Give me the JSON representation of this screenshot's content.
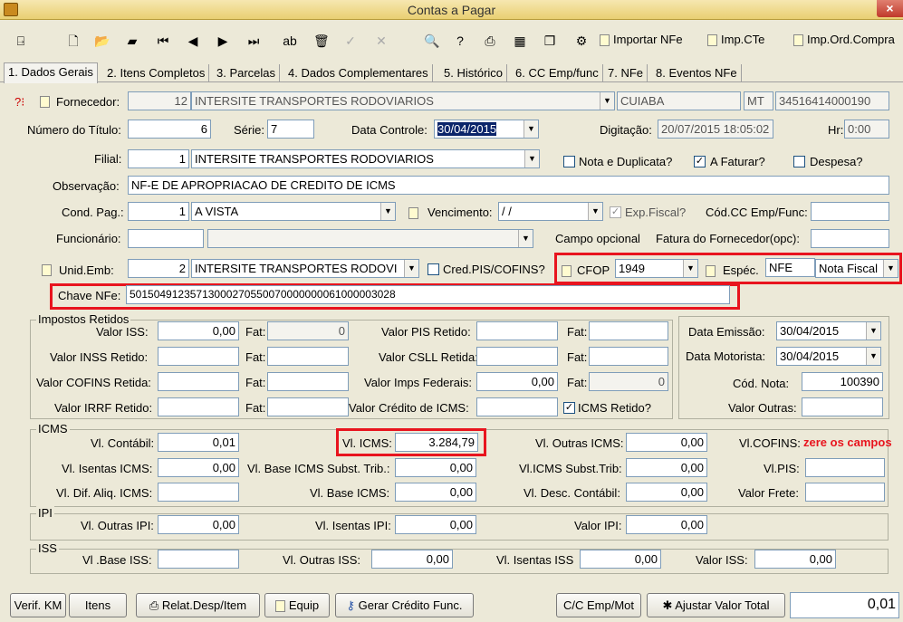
{
  "window": {
    "title": "Contas a Pagar",
    "close_glyph": "×"
  },
  "toolbar": {
    "importar_nfe": "Importar NFe",
    "imp_cte": "Imp.CTe",
    "imp_ord_compra": "Imp.Ord.Compra"
  },
  "tabs": [
    {
      "label": "1. Dados Gerais"
    },
    {
      "label": "2. Itens Completos"
    },
    {
      "label": "3. Parcelas"
    },
    {
      "label": "4. Dados Complementares"
    },
    {
      "label": "5. Histórico"
    },
    {
      "label": "6. CC Emp/func"
    },
    {
      "label": "7. NFe"
    },
    {
      "label": "8. Eventos NFe"
    }
  ],
  "form": {
    "fornecedor_label": "Fornecedor:",
    "fornecedor_code": "12",
    "fornecedor_name": "INTERSITE TRANSPORTES RODOVIARIOS",
    "cidade": "CUIABA",
    "uf": "MT",
    "cnpj": "34516414000190",
    "numero_titulo_label": "Número do Título:",
    "numero_titulo": "6",
    "serie_label": "Série:",
    "serie": "7",
    "data_controle_label": "Data Controle:",
    "data_controle": "30/04/2015",
    "digitacao_label": "Digitação:",
    "digitacao": "20/07/2015 18:05:02",
    "hr_label": "Hr:",
    "hr": "0:00",
    "filial_label": "Filial:",
    "filial_code": "1",
    "filial_name": "INTERSITE TRANSPORTES RODOVIARIOS",
    "nota_duplicata_label": "Nota e Duplicata?",
    "a_faturar_label": "A Faturar?",
    "despesa_label": "Despesa?",
    "observacao_label": "Observação:",
    "observacao": "NF-E DE APROPRIACAO DE CREDITO DE ICMS",
    "cond_pag_label": "Cond. Pag.:",
    "cond_pag_code": "1",
    "cond_pag_name": "A VISTA",
    "vencimento_label": "Vencimento:",
    "vencimento": " / /",
    "exp_fiscal_label": "Exp.Fiscal?",
    "cod_cc_label": "Cód.CC Emp/Func:",
    "funcionario_label": "Funcionário:",
    "campo_opcional_label": "Campo opcional",
    "fatura_fornecedor_label": "Fatura do Fornecedor(opc):",
    "unid_emb_label": "Unid.Emb:",
    "unid_emb_code": "2",
    "unid_emb_name": "INTERSITE TRANSPORTES RODOVI",
    "cred_pis_label": "Cred.PIS/COFINS?",
    "cfop_label": "CFOP",
    "cfop": "1949",
    "especie_label": "Espéc.",
    "especie_code": "NFE",
    "especie_name": "Nota Fiscal",
    "chave_nfe_label": "Chave NFe:",
    "chave_nfe": "50150491235713000270550070000000061000003028"
  },
  "impostos": {
    "title": "Impostos Retidos",
    "valor_iss_label": "Valor ISS:",
    "valor_iss": "0,00",
    "fat_label": "Fat:",
    "fat_iss": "0",
    "valor_inss_label": "Valor INSS Retido:",
    "valor_cofins_label": "Valor COFINS Retida:",
    "valor_irrf_label": "Valor IRRF Retido:",
    "valor_pis_label": "Valor PIS Retido:",
    "valor_csll_label": "Valor CSLL Retida:",
    "valor_imps_fed_label": "Valor Imps Federais:",
    "valor_imps_fed": "0,00",
    "fat_imps_fed": "0",
    "valor_cred_icms_label": "Valor Crédito de ICMS:",
    "icms_retido_label": "ICMS Retido?"
  },
  "datas": {
    "data_emissao_label": "Data Emissão:",
    "data_emissao": "30/04/2015",
    "data_motorista_label": "Data Motorista:",
    "data_motorista": "30/04/2015",
    "cod_nota_label": "Cód. Nota:",
    "cod_nota": "100390",
    "valor_outras_label": "Valor Outras:"
  },
  "icms": {
    "title": "ICMS",
    "vl_contabil_label": "Vl. Contábil:",
    "vl_contabil": "0,01",
    "vl_isentas_label": "Vl. Isentas ICMS:",
    "vl_isentas": "0,00",
    "vl_dif_aliq_label": "Vl. Dif. Aliq. ICMS:",
    "vl_icms_label": "Vl. ICMS:",
    "vl_icms": "3.284,79",
    "vl_base_subst_label": "Vl. Base ICMS Subst. Trib.:",
    "vl_base_subst": "0,00",
    "vl_base_icms_label": "Vl. Base ICMS:",
    "vl_base_icms": "0,00",
    "vl_outras_icms_label": "Vl. Outras ICMS:",
    "vl_outras_icms": "0,00",
    "vl_icms_subst_label": "Vl.ICMS Subst.Trib:",
    "vl_icms_subst": "0,00",
    "vl_desc_contabil_label": "Vl. Desc. Contábil:",
    "vl_desc_contabil": "0,00",
    "vl_cofins_label": "Vl.COFINS:",
    "vl_pis_label": "Vl.PIS:",
    "valor_frete_label": "Valor Frete:",
    "annotation": "zere os campos"
  },
  "ipi": {
    "title": "IPI",
    "vl_outras_ipi_label": "Vl. Outras IPI:",
    "vl_outras_ipi": "0,00",
    "vl_isentas_ipi_label": "Vl. Isentas IPI:",
    "vl_isentas_ipi": "0,00",
    "valor_ipi_label": "Valor IPI:",
    "valor_ipi": "0,00"
  },
  "iss": {
    "title": "ISS",
    "vl_base_iss_label": "Vl .Base ISS:",
    "vl_outras_iss_label": "Vl. Outras ISS:",
    "vl_outras_iss": "0,00",
    "vl_isentas_iss_label": "Vl. Isentas ISS",
    "vl_isentas_iss": "0,00",
    "valor_iss_label": "Valor ISS:",
    "valor_iss": "0,00"
  },
  "footer": {
    "verif_km": "Verif. KM",
    "itens": "Itens",
    "relat_desp": "Relat.Desp/Item",
    "equip": "Equip",
    "gerar_credito": "Gerar Crédito Func.",
    "cc_emp_mot": "C/C Emp/Mot",
    "ajustar_valor": "Ajustar Valor Total",
    "total": "0,01"
  }
}
